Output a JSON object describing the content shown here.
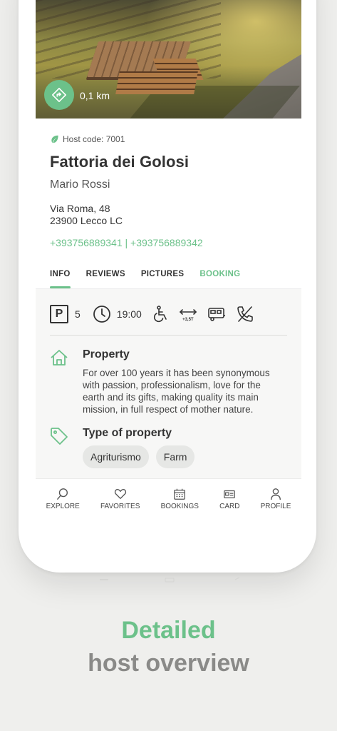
{
  "hero": {
    "distance": "0,1 km"
  },
  "host": {
    "code_label": "Host code: 7001",
    "name": "Fattoria dei Golosi",
    "owner": "Mario Rossi",
    "address_line1": "Via Roma, 48",
    "address_line2": "23900 Lecco LC",
    "phones": "+393756889341 | +393756889342"
  },
  "tabs": [
    {
      "label": "INFO",
      "active": true
    },
    {
      "label": "REVIEWS",
      "active": false
    },
    {
      "label": "PICTURES",
      "active": false
    },
    {
      "label": "BOOKING",
      "active": false
    }
  ],
  "amenities": {
    "parking_icon": "P",
    "parking_count": "5",
    "closing_time": "19:00",
    "weight_label": "+3,5T",
    "icons": [
      "parking-icon",
      "clock-icon",
      "wheelchair-icon",
      "vehicle-length-icon",
      "camper-icon",
      "no-phone-icon"
    ]
  },
  "property": {
    "title": "Property",
    "description": "For over 100 years it has been synonymous with passion, professionalism, love for the earth and its gifts, making quality its main mission, in full respect of mother nature."
  },
  "property_type": {
    "title": "Type of property",
    "chips": [
      "Agriturismo",
      "Farm"
    ]
  },
  "nav": [
    {
      "label": "EXPLORE",
      "icon": "search-icon"
    },
    {
      "label": "FAVORITES",
      "icon": "heart-icon"
    },
    {
      "label": "BOOKINGS",
      "icon": "calendar-icon"
    },
    {
      "label": "CARD",
      "icon": "card-icon"
    },
    {
      "label": "PROFILE",
      "icon": "user-icon"
    }
  ],
  "colors": {
    "accent": "#6cc18a",
    "grey_text": "#8a8a88"
  },
  "tagline": {
    "line1": "Detailed",
    "line2": "host overview"
  }
}
